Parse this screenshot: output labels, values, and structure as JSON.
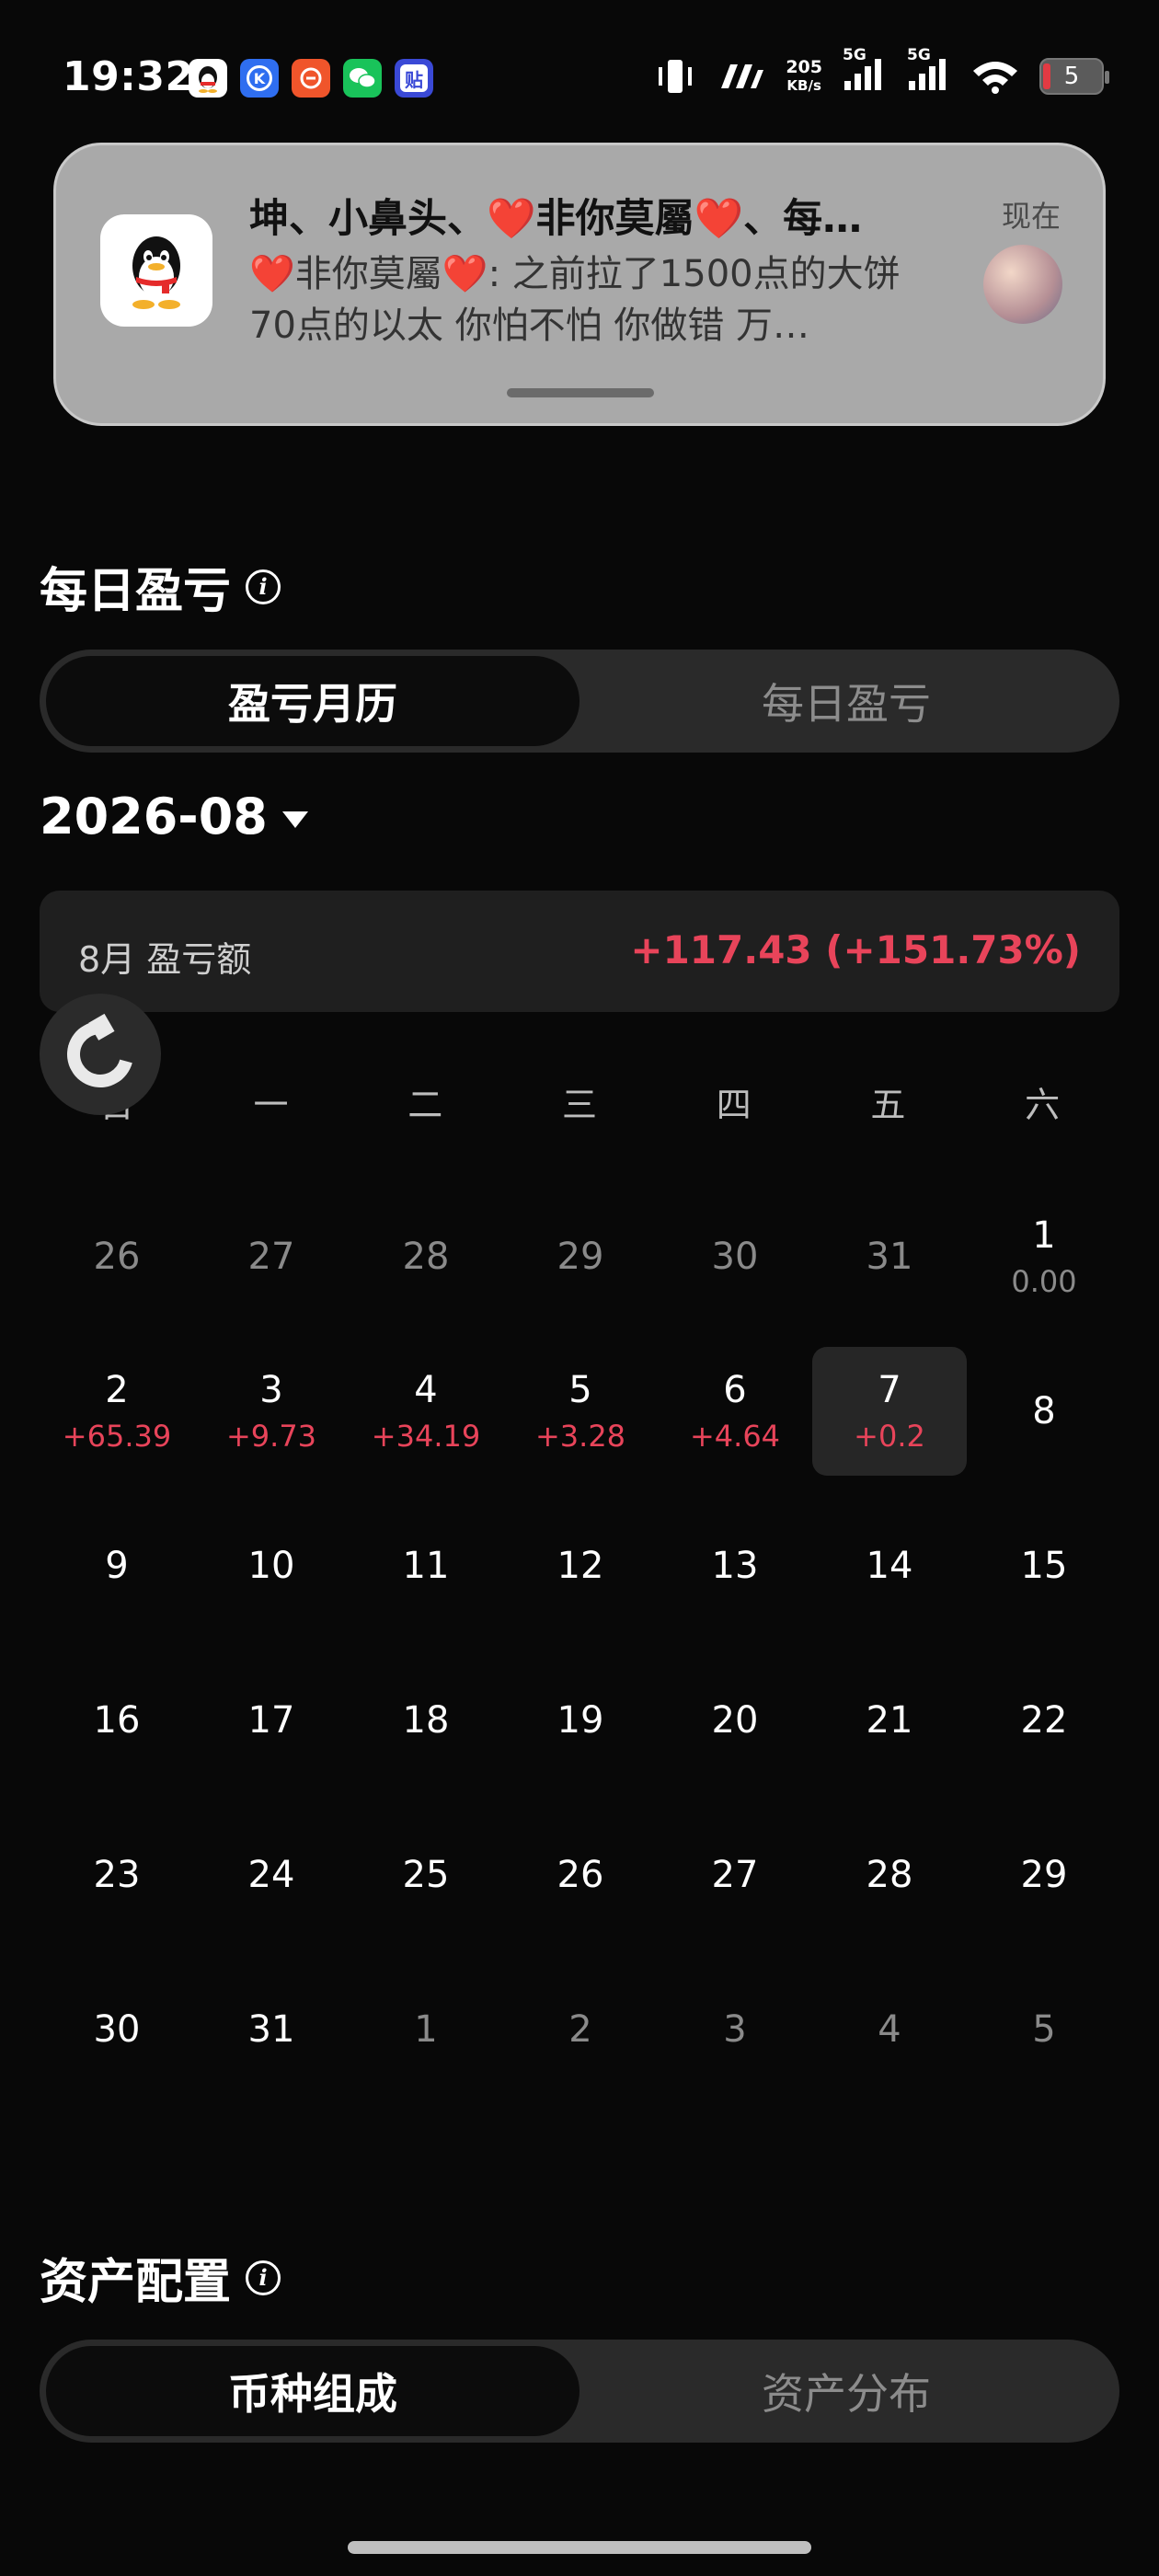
{
  "status_bar": {
    "time": "19:32",
    "net_speed_value": "205",
    "net_speed_unit": "KB/s",
    "sim1": "5G",
    "sim2": "5G",
    "battery": "5"
  },
  "notification": {
    "title": "坤、小鼻头、❤️非你莫屬❤️、每…",
    "body": "❤️非你莫屬❤️: 之前拉了1500点的大饼 70点的以太 你怕不怕 你做错 万…",
    "time": "现在"
  },
  "daily_pnl": {
    "title": "每日盈亏",
    "tabs": [
      "盈亏月历",
      "每日盈亏"
    ],
    "month": "2026-08",
    "summary_label": "8月 盈亏额",
    "summary_value": "+117.43 (+151.73%)",
    "weekdays": [
      "日",
      "一",
      "二",
      "三",
      "四",
      "五",
      "六"
    ],
    "days": [
      {
        "n": "26",
        "p": "",
        "t": "other"
      },
      {
        "n": "27",
        "p": "",
        "t": "other"
      },
      {
        "n": "28",
        "p": "",
        "t": "other"
      },
      {
        "n": "29",
        "p": "",
        "t": "other"
      },
      {
        "n": "30",
        "p": "",
        "t": "other"
      },
      {
        "n": "31",
        "p": "",
        "t": "other"
      },
      {
        "n": "1",
        "p": "0.00",
        "t": "cur"
      },
      {
        "n": "2",
        "p": "+65.39",
        "t": "cur"
      },
      {
        "n": "3",
        "p": "+9.73",
        "t": "cur"
      },
      {
        "n": "4",
        "p": "+34.19",
        "t": "cur"
      },
      {
        "n": "5",
        "p": "+3.28",
        "t": "cur"
      },
      {
        "n": "6",
        "p": "+4.64",
        "t": "cur"
      },
      {
        "n": "7",
        "p": "+0.2",
        "t": "cur",
        "selected": true
      },
      {
        "n": "8",
        "p": "",
        "t": "cur"
      },
      {
        "n": "9",
        "p": "",
        "t": "cur"
      },
      {
        "n": "10",
        "p": "",
        "t": "cur"
      },
      {
        "n": "11",
        "p": "",
        "t": "cur"
      },
      {
        "n": "12",
        "p": "",
        "t": "cur"
      },
      {
        "n": "13",
        "p": "",
        "t": "cur"
      },
      {
        "n": "14",
        "p": "",
        "t": "cur"
      },
      {
        "n": "15",
        "p": "",
        "t": "cur"
      },
      {
        "n": "16",
        "p": "",
        "t": "cur"
      },
      {
        "n": "17",
        "p": "",
        "t": "cur"
      },
      {
        "n": "18",
        "p": "",
        "t": "cur"
      },
      {
        "n": "19",
        "p": "",
        "t": "cur"
      },
      {
        "n": "20",
        "p": "",
        "t": "cur"
      },
      {
        "n": "21",
        "p": "",
        "t": "cur"
      },
      {
        "n": "22",
        "p": "",
        "t": "cur"
      },
      {
        "n": "23",
        "p": "",
        "t": "cur"
      },
      {
        "n": "24",
        "p": "",
        "t": "cur"
      },
      {
        "n": "25",
        "p": "",
        "t": "cur"
      },
      {
        "n": "26",
        "p": "",
        "t": "cur"
      },
      {
        "n": "27",
        "p": "",
        "t": "cur"
      },
      {
        "n": "28",
        "p": "",
        "t": "cur"
      },
      {
        "n": "29",
        "p": "",
        "t": "cur"
      },
      {
        "n": "30",
        "p": "",
        "t": "cur"
      },
      {
        "n": "31",
        "p": "",
        "t": "cur"
      },
      {
        "n": "1",
        "p": "",
        "t": "other"
      },
      {
        "n": "2",
        "p": "",
        "t": "other"
      },
      {
        "n": "3",
        "p": "",
        "t": "other"
      },
      {
        "n": "4",
        "p": "",
        "t": "other"
      },
      {
        "n": "5",
        "p": "",
        "t": "other"
      }
    ]
  },
  "asset_allocation": {
    "title": "资产配置",
    "tabs": [
      "币种组成",
      "资产分布"
    ]
  },
  "colors": {
    "background": "#080808",
    "profit": "#e8445a",
    "muted": "#8a8a8a"
  }
}
